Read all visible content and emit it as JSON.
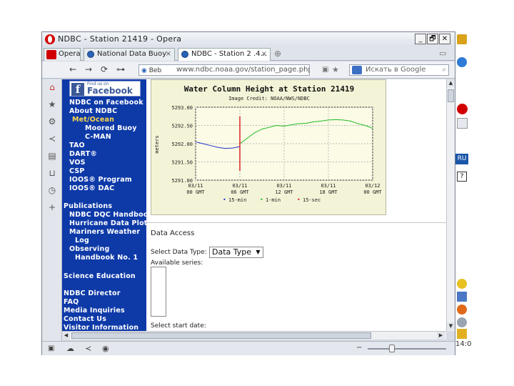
{
  "window": {
    "title": "NDBC - Station 21419 - Opera",
    "controls": {
      "minimize": "_",
      "maximize": "🗗",
      "close": "✕"
    }
  },
  "tabs": [
    {
      "label": "Opera",
      "active": false
    },
    {
      "label": "National Data Buoy",
      "active": false,
      "close": "×"
    },
    {
      "label": "NDBC - Station 2 .4...",
      "active": true,
      "close": "×"
    }
  ],
  "toolbar": {
    "nav_glyphs": {
      "back": "←",
      "forward": "→",
      "reload": "⟳",
      "key": "⊶"
    },
    "address_badge": "Beb",
    "url": "www.ndbc.noaa.gov/station_page.php",
    "search_placeholder": "Искать в Google"
  },
  "sidebar_nav": {
    "facebook_small": "Find us on",
    "facebook_label": "Facebook",
    "items": [
      "NDBC on Facebook",
      "About NDBC",
      "Met/Ocean",
      "Moored Buoy",
      "C-MAN",
      "TAO",
      "DART®",
      "VOS",
      "CSP",
      "IOOS® Program",
      "IOOS® DAC",
      "Publications",
      "NDBC DQC Handbook",
      "Hurricane Data Plots",
      "Mariners Weather",
      "Log",
      "Observing",
      "Handbook No. 1",
      "Science Education",
      "NDBC Director",
      "FAQ",
      "Media Inquiries",
      "Contact Us",
      "Visitor Information"
    ]
  },
  "chart_data": {
    "type": "line",
    "title": "Water Column Height at Station 21419",
    "subtitle": "Image Credit: NOAA/NWS/NDBC",
    "ylabel": "meters",
    "ylim": [
      5291.0,
      5293.0
    ],
    "yticks": [
      "5293.00",
      "5292.50",
      "5292.00",
      "5291.50",
      "5291.00"
    ],
    "xticks": [
      [
        "03/11",
        "00 GMT"
      ],
      [
        "03/11",
        "06 GMT"
      ],
      [
        "03/11",
        "12 GMT"
      ],
      [
        "03/11",
        "18 GMT"
      ],
      [
        "03/12",
        "00 GMT"
      ]
    ],
    "legend": [
      {
        "label": "15-min",
        "color": "#2233cc"
      },
      {
        "label": "1-min",
        "color": "#22bb22"
      },
      {
        "label": "15-sec",
        "color": "#dd2222"
      }
    ],
    "series": [
      {
        "name": "15-min",
        "color": "#2233cc",
        "x": [
          0,
          1,
          2,
          3,
          4,
          5,
          6
        ],
        "y": [
          5292.05,
          5292.0,
          5291.95,
          5291.9,
          5291.87,
          5291.88,
          5291.92
        ]
      },
      {
        "name": "1-min",
        "color": "#22bb22",
        "x": [
          6,
          7,
          8,
          9,
          10,
          11,
          12,
          13,
          14,
          15,
          16,
          17,
          18,
          19,
          20,
          21,
          22,
          23,
          24
        ],
        "y": [
          5292.0,
          5292.15,
          5292.3,
          5292.4,
          5292.45,
          5292.5,
          5292.48,
          5292.52,
          5292.55,
          5292.56,
          5292.6,
          5292.62,
          5292.65,
          5292.66,
          5292.65,
          5292.62,
          5292.55,
          5292.5,
          5292.42
        ]
      },
      {
        "name": "15-sec",
        "color": "#dd2222",
        "x": [
          6,
          6
        ],
        "y": [
          5291.25,
          5292.75
        ]
      }
    ],
    "xlim": [
      0,
      24
    ]
  },
  "data_access": {
    "heading": "Data Access",
    "select_label": "Select Data Type:",
    "select_value": "Data Type",
    "series_label": "Available series:",
    "start_label": "Select start date:"
  },
  "right_panel": {
    "label": "RU",
    "clock": "14:0"
  }
}
